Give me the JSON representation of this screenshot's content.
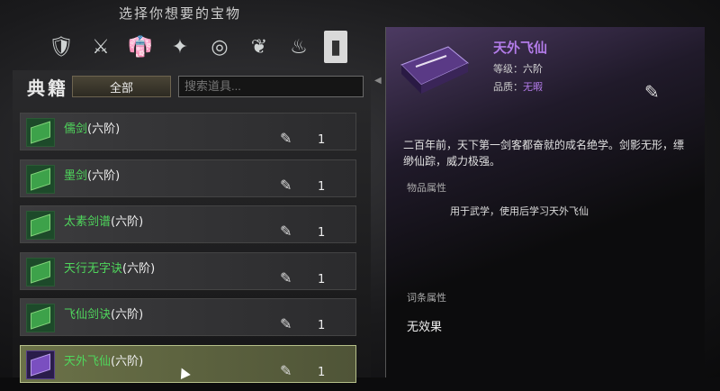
{
  "header": {
    "title": "选择你想要的宝物"
  },
  "categories": [
    {
      "icon": "armor-icon",
      "glyph": "🛡"
    },
    {
      "icon": "weapon-icon",
      "glyph": "⚔"
    },
    {
      "icon": "robe-icon",
      "glyph": "👘"
    },
    {
      "icon": "accessory-icon",
      "glyph": "✦"
    },
    {
      "icon": "bead-icon",
      "glyph": "◎"
    },
    {
      "icon": "herb-icon",
      "glyph": "❦"
    },
    {
      "icon": "pouch-icon",
      "glyph": "♨"
    },
    {
      "icon": "book-icon",
      "glyph": "▮"
    }
  ],
  "panel": {
    "section_title": "典籍",
    "filter_label": "全部",
    "search_placeholder": "搜索道具..."
  },
  "items": [
    {
      "name": "儒剑",
      "tier": "(六阶)",
      "qty": "1"
    },
    {
      "name": "墨剑",
      "tier": "(六阶)",
      "qty": "1"
    },
    {
      "name": "太素剑谱",
      "tier": "(六阶)",
      "qty": "1"
    },
    {
      "name": "天行无字诀",
      "tier": "(六阶)",
      "qty": "1"
    },
    {
      "name": "飞仙剑诀",
      "tier": "(六阶)",
      "qty": "1"
    },
    {
      "name": "天外飞仙",
      "tier": "(六阶)",
      "qty": "1"
    }
  ],
  "detail": {
    "name": "天外飞仙",
    "level_label": "等级：",
    "level_value": "六阶",
    "quality_label": "品质：",
    "quality_value": "无暇",
    "description": "二百年前，天下第一剑客都奋就的成名绝学。剑影无形，缥缈仙踪，威力极强。",
    "item_attr_label": "物品属性",
    "item_attr_value": "用于武学，使用后学习天外飞仙",
    "entry_attr_label": "词条属性",
    "entry_attr_value": "无效果"
  },
  "colors": {
    "accent_green": "#4fd65c",
    "accent_purple": "#b27be8"
  }
}
